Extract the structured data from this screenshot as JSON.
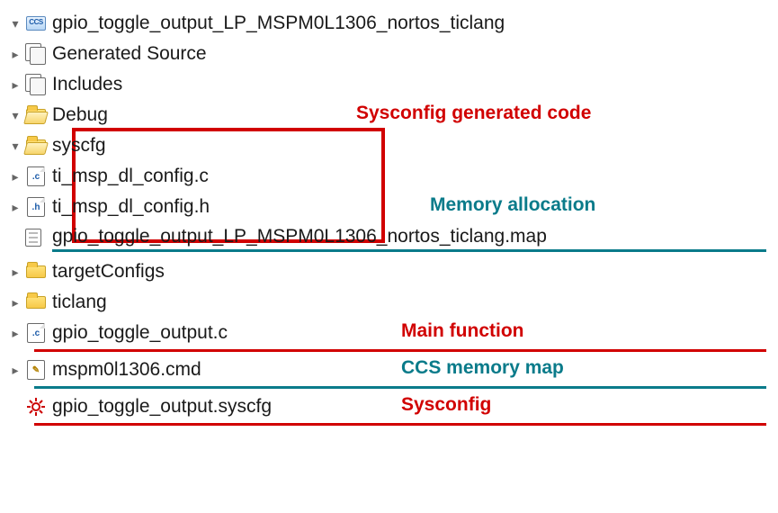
{
  "project": {
    "root": "gpio_toggle_output_LP_MSPM0L1306_nortos_ticlang",
    "nodes": {
      "generated_source": "Generated Source",
      "includes": "Includes",
      "debug": "Debug",
      "syscfg_folder": "syscfg",
      "syscfg_c": "ti_msp_dl_config.c",
      "syscfg_h": "ti_msp_dl_config.h",
      "map_file": "gpio_toggle_output_LP_MSPM0L1306_nortos_ticlang.map",
      "target_configs": "targetConfigs",
      "ticlang": "ticlang",
      "main_c": "gpio_toggle_output.c",
      "cmd_file": "mspm0l1306.cmd",
      "syscfg_file": "gpio_toggle_output.syscfg"
    }
  },
  "annotations": {
    "syscfg_code": "Sysconfig generated code",
    "mem_alloc": "Memory allocation",
    "main_fn": "Main function",
    "ccs_map": "CCS memory map",
    "sysconfig": "Sysconfig"
  }
}
